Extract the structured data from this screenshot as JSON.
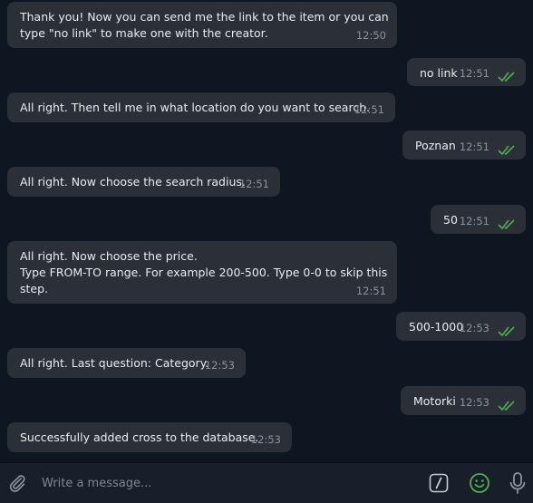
{
  "colors": {
    "background": "#0e1621",
    "bubble": "#2a2f38",
    "read_check": "#4fae4e",
    "emoji_icon": "#4fae4e",
    "timestamp": "#8a949e"
  },
  "messages": [
    {
      "direction": "in",
      "text": "Thank you! Now you can send me the link to the item or you can\ntype \"no link\" to make one with the creator.",
      "time": "12:50"
    },
    {
      "direction": "out",
      "text": "no link",
      "time": "12:51",
      "status": "read"
    },
    {
      "direction": "in",
      "text": "All right. Then tell me in what location do you want to search.",
      "time": "12:51"
    },
    {
      "direction": "out",
      "text": "Poznan",
      "time": "12:51",
      "status": "read"
    },
    {
      "direction": "in",
      "text": "All right. Now choose the search radius.",
      "time": "12:51"
    },
    {
      "direction": "out",
      "text": "50",
      "time": "12:51",
      "status": "read"
    },
    {
      "direction": "in",
      "text": "All right. Now choose the price.\nType FROM-TO range. For example 200-500. Type 0-0 to skip this\nstep.",
      "time": "12:51"
    },
    {
      "direction": "out",
      "text": "500-1000",
      "time": "12:53",
      "status": "read"
    },
    {
      "direction": "in",
      "text": "All right. Last question: Category.",
      "time": "12:53"
    },
    {
      "direction": "out",
      "text": "Motorki",
      "time": "12:53",
      "status": "read"
    },
    {
      "direction": "in",
      "text": "Successfully added cross to the database.",
      "time": "12:53"
    }
  ],
  "composer": {
    "placeholder": "Write a message...",
    "value": "",
    "icons": [
      "paperclip-icon",
      "bot-command-icon",
      "emoji-icon",
      "microphone-icon"
    ]
  }
}
